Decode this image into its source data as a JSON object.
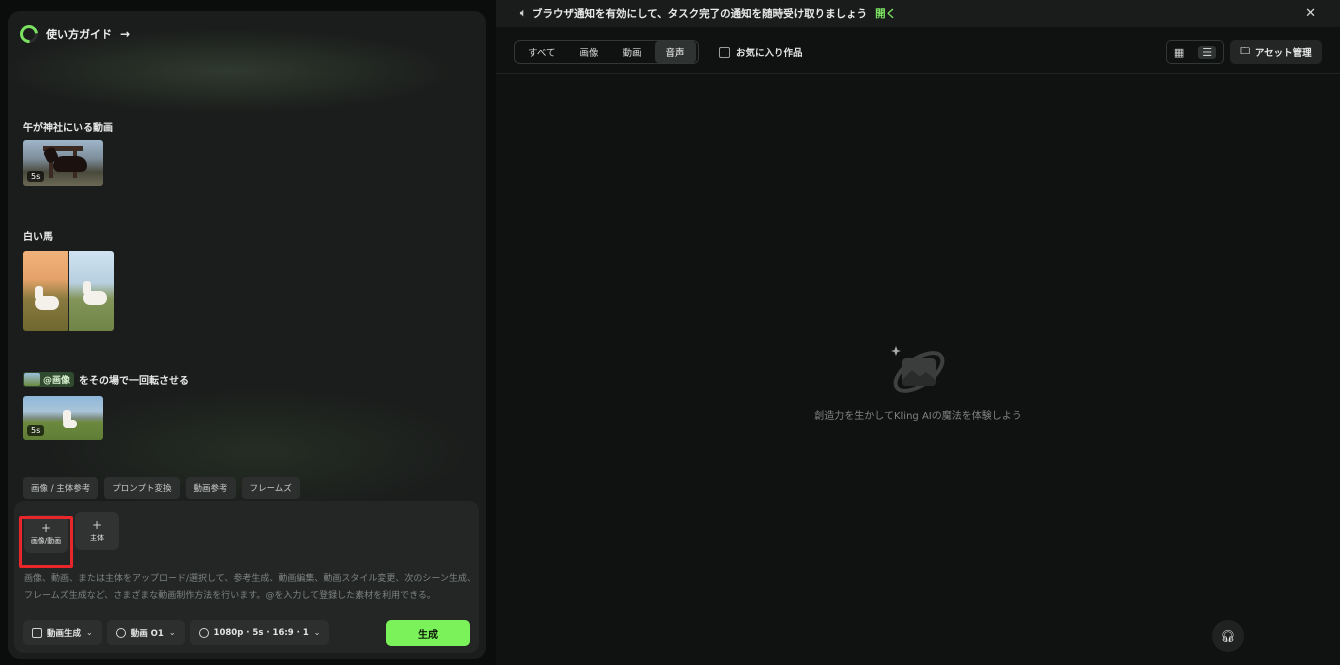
{
  "left": {
    "guide_label": "使い方ガイド",
    "guide_arrow": "→",
    "examples": [
      {
        "label": "午が神社にいる動画",
        "duration": "5s"
      },
      {
        "label": "白い馬"
      },
      {
        "chip": "@画像",
        "label": "をその場で一回転させる",
        "duration": "5s"
      }
    ],
    "pills": [
      "画像 / 主体参考",
      "プロンプト変換",
      "動画参考",
      "フレームズ"
    ],
    "add_media_label": "画像/動画",
    "add_subject_label": "主体",
    "plus": "+",
    "prompt_placeholder": "画像、動画、または主体をアップロード/選択して、参考生成、動画編集、動画スタイル変更、次のシーン生成、フレームズ生成など、さまざまな動画制作方法を行います。@を入力して登録した素材を利用できる。",
    "controls": [
      {
        "label": "動画生成",
        "icon": "calendar-icon"
      },
      {
        "label": "動画 O1",
        "icon": "model-icon"
      },
      {
        "label": "1080p · 5s · 16:9 · 1",
        "icon": "settings-icon"
      }
    ],
    "generate_label": "生成",
    "accent_color": "#7bf15a"
  },
  "right": {
    "notice_text": "ブラウザ通知を有効にして、タスク完了の通知を随時受け取りましょう",
    "notice_link": "開く",
    "close_glyph": "✕",
    "tabs": [
      "すべて",
      "画像",
      "動画",
      "音声"
    ],
    "active_tab": "音声",
    "favorites_label": "お気に入り作品",
    "asset_label": "アセット管理",
    "empty_text": "創造力を生かしてKling AIの魔法を体験しよう"
  }
}
